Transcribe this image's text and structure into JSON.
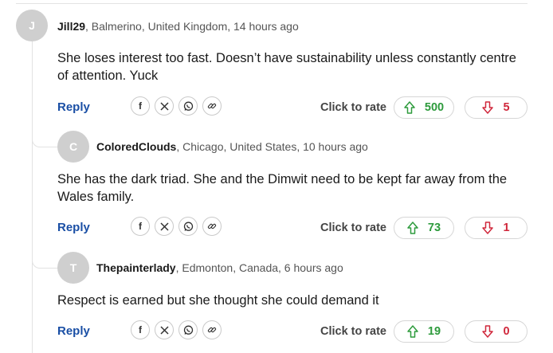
{
  "ui": {
    "reply_label": "Reply",
    "rate_label": "Click to rate"
  },
  "comments": [
    {
      "initial": "J",
      "username": "Jill29",
      "location_time": ", Balmerino, United Kingdom, 14 hours ago",
      "body": "She loses interest too fast. Doesn’t have sustainability unless constantly centre of attention. Yuck",
      "upvotes": "500",
      "downvotes": "5"
    },
    {
      "initial": "C",
      "username": "ColoredClouds",
      "location_time": ", Chicago, United States, 10 hours ago",
      "body": "She has the dark triad. She and the Dimwit need to be kept far away from the Wales family.",
      "upvotes": "73",
      "downvotes": "1"
    },
    {
      "initial": "T",
      "username": "Thepainterlady",
      "location_time": ", Edmonton, Canada, 6 hours ago",
      "body": "Respect is earned but she thought she could demand it",
      "upvotes": "19",
      "downvotes": "0"
    }
  ],
  "share_icons": [
    "facebook-icon",
    "x-icon",
    "whatsapp-icon",
    "link-icon"
  ],
  "colors": {
    "reply": "#1a4fa5",
    "upvote": "#2e9b3d",
    "downvote": "#d0283c",
    "avatar": "#cfcfcf"
  }
}
